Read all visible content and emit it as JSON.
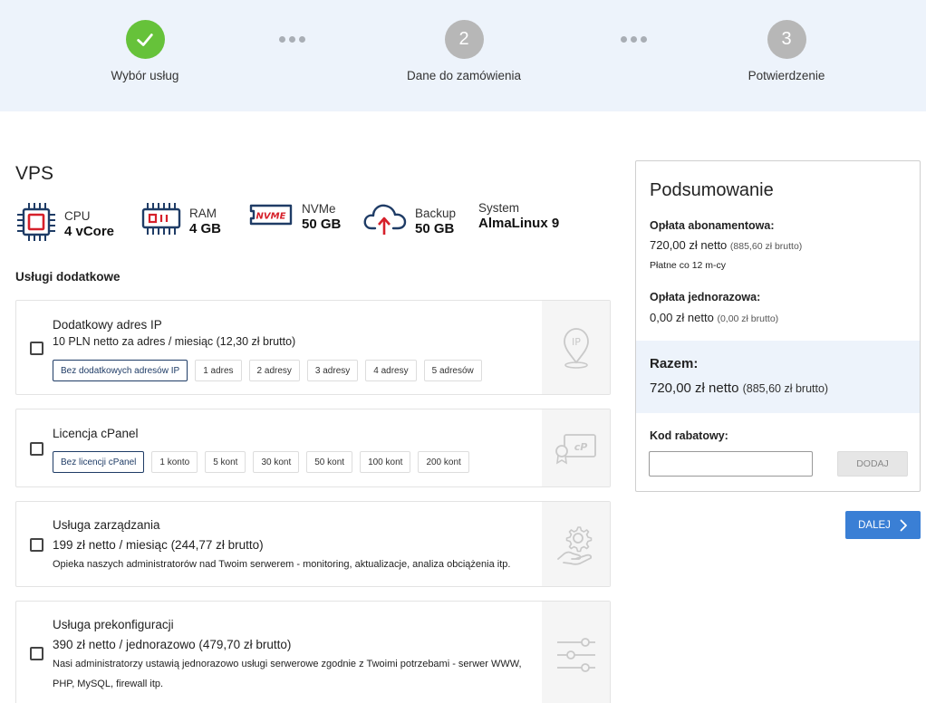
{
  "stepper": {
    "steps": [
      {
        "number": "",
        "label": "Wybór usług",
        "state": "done"
      },
      {
        "number": "2",
        "label": "Dane do zamówienia",
        "state": "todo"
      },
      {
        "number": "3",
        "label": "Potwierdzenie",
        "state": "todo"
      }
    ]
  },
  "product": {
    "title": "VPS",
    "specs": [
      {
        "icon": "cpu-icon",
        "key": "CPU",
        "value": "4 vCore"
      },
      {
        "icon": "ram-icon",
        "key": "RAM",
        "value": "4 GB"
      },
      {
        "icon": "nvme-icon",
        "key": "NVMe",
        "value": "50 GB"
      },
      {
        "icon": "cloud-upload-icon",
        "key": "Backup",
        "value": "50 GB"
      },
      {
        "icon": "",
        "key": "System",
        "value": "AlmaLinux 9"
      }
    ]
  },
  "extras": {
    "title": "Usługi dodatkowe",
    "ip": {
      "name": "Dodatkowy adres IP",
      "price": "10 PLN netto za adres / miesiąc (12,30 zł brutto)",
      "options": [
        "Bez dodatkowych adresów IP",
        "1 adres",
        "2 adresy",
        "3 adresy",
        "4 adresy",
        "5 adresów"
      ],
      "selected": 0,
      "icon": "ip-location-icon",
      "icon_text": "IP"
    },
    "cpanel": {
      "name": "Licencja cPanel",
      "options": [
        "Bez licencji cPanel",
        "1 konto",
        "5 kont",
        "30 kont",
        "50 kont",
        "100 kont",
        "200 kont"
      ],
      "selected": 0,
      "icon": "cpanel-license-icon",
      "icon_text": "cP"
    },
    "management": {
      "name": "Usługa zarządzania",
      "price": "199 zł netto / miesiąc (244,77 zł brutto)",
      "description": "Opieka naszych administratorów nad Twoim serwerem - monitoring, aktualizacje, analiza obciążenia itp.",
      "icon": "gear-hand-icon"
    },
    "preconfig": {
      "name": "Usługa prekonfiguracji",
      "price": "390 zł netto / jednorazowo (479,70 zł brutto)",
      "description": "Nasi administratorzy ustawią jednorazowo usługi serwerowe zgodnie z Twoimi potrzebami - serwer WWW, PHP, MySQL, firewall itp.",
      "icon": "sliders-icon"
    }
  },
  "summary": {
    "title": "Podsumowanie",
    "subscription_label": "Opłata abonamentowa:",
    "subscription_net": "720,00 zł netto",
    "subscription_gross": "(885,60 zł brutto)",
    "subscription_note": "Płatne co 12 m-cy",
    "onetime_label": "Opłata jednorazowa:",
    "onetime_net": "0,00 zł netto",
    "onetime_gross": "(0,00 zł brutto)",
    "total_label": "Razem:",
    "total_net": "720,00 zł netto",
    "total_gross": "(885,60 zł brutto)",
    "code_label": "Kod rabatowy:",
    "code_value": "",
    "code_button": "DODAJ"
  },
  "next_button": "DALEJ",
  "colors": {
    "accent": "#3a7fd5",
    "done": "#66c23a",
    "todo": "#b7b7b7",
    "stepper_bg": "#edf3fb",
    "icon_red": "#d6202a",
    "icon_navy": "#1f3c66"
  }
}
